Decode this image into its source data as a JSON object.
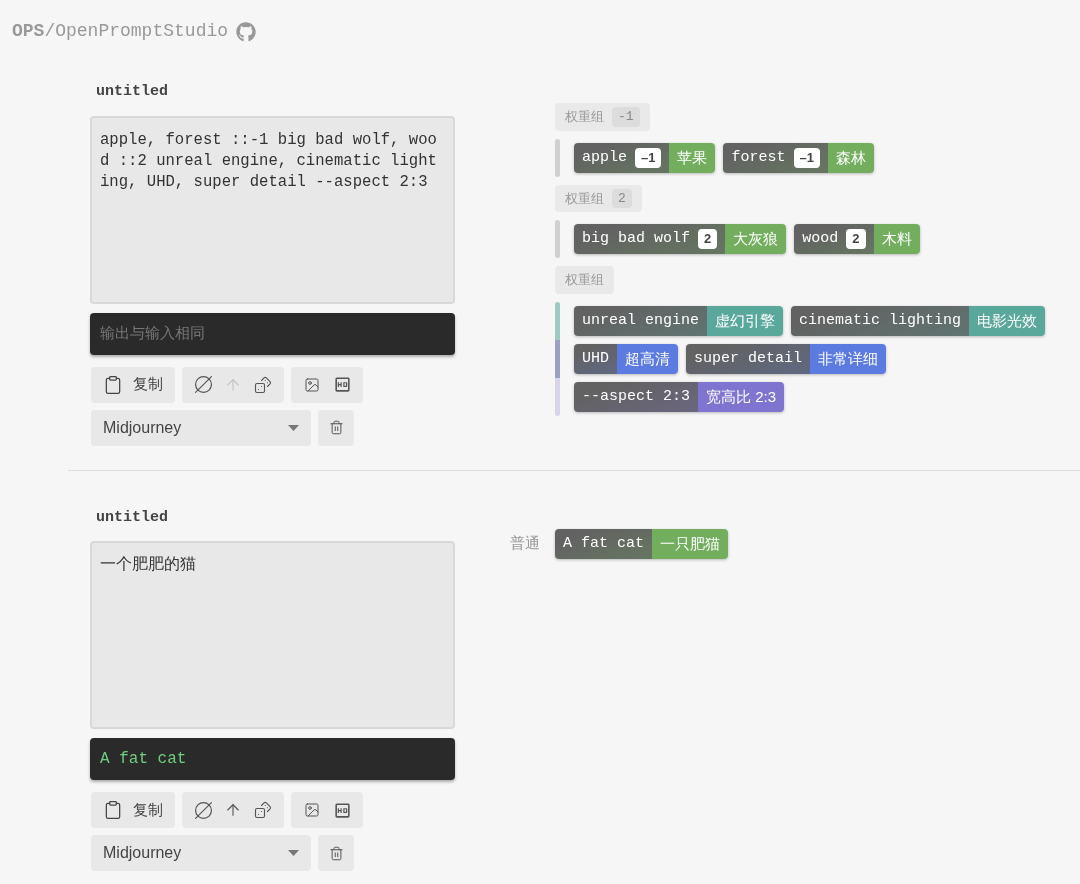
{
  "header": {
    "brand": "**OPS**/OpenPromptStudio"
  },
  "blocks": [
    {
      "title": "untitled",
      "input": "apple, forest ::-1 big bad wolf, wood ::2 unreal engine, cinematic lighting, UHD, super detail --aspect 2:3",
      "output": {
        "placeholder": "输出与输入相同"
      },
      "toolbar": {
        "copy_label": "复制",
        "upload_disabled": true
      },
      "model": "Midjourney",
      "groups": [
        {
          "kind": "weight",
          "label": "权重组",
          "weight": "-1",
          "rows": [
            {
              "color": "#d0d0d0",
              "tags": [
                {
                  "text": "apple",
                  "weight": "–1",
                  "translation": "苹果",
                  "color": "#72ae5e"
                },
                {
                  "text": "forest",
                  "weight": "–1",
                  "translation": "森林",
                  "color": "#72ae5e"
                }
              ]
            }
          ]
        },
        {
          "kind": "weight",
          "label": "权重组",
          "weight": "2",
          "rows": [
            {
              "color": "#d0d0d0",
              "tags": [
                {
                  "text": "big bad wolf",
                  "weight": "2",
                  "translation": "大灰狼",
                  "color": "#72ae5e"
                },
                {
                  "text": "wood",
                  "weight": "2",
                  "translation": "木料",
                  "color": "#72ae5e"
                }
              ]
            }
          ]
        },
        {
          "kind": "weight",
          "label": "权重组",
          "rows": [
            {
              "color": "#9fc9c2",
              "tags": [
                {
                  "text": "unreal engine",
                  "translation": "虚幻引擎",
                  "color": "#5aa89c"
                },
                {
                  "text": "cinematic lighting",
                  "translation": "电影光效",
                  "color": "#5aa89c"
                }
              ]
            },
            {
              "color": "#9aa1c2",
              "tags": [
                {
                  "text": "UHD",
                  "translation": "超高清",
                  "color": "#5b7be0"
                },
                {
                  "text": "super detail",
                  "translation": "非常详细",
                  "color": "#5b7be0"
                }
              ]
            },
            {
              "color": "#d8d4ee",
              "tags": [
                {
                  "text": "--aspect 2:3",
                  "translation": "宽高比 2:3",
                  "color": "#7f74cf"
                }
              ]
            }
          ]
        }
      ]
    },
    {
      "title": "untitled",
      "input": "一个肥肥的猫",
      "output": {
        "value": "A fat cat"
      },
      "toolbar": {
        "copy_label": "复制",
        "upload_disabled": false
      },
      "model": "Midjourney",
      "groups": [
        {
          "kind": "normal",
          "label": "普通",
          "rows": [
            {
              "tags": [
                {
                  "text": "A fat cat",
                  "translation": "一只肥猫",
                  "color": "#72ae5e"
                }
              ]
            }
          ]
        }
      ]
    }
  ]
}
